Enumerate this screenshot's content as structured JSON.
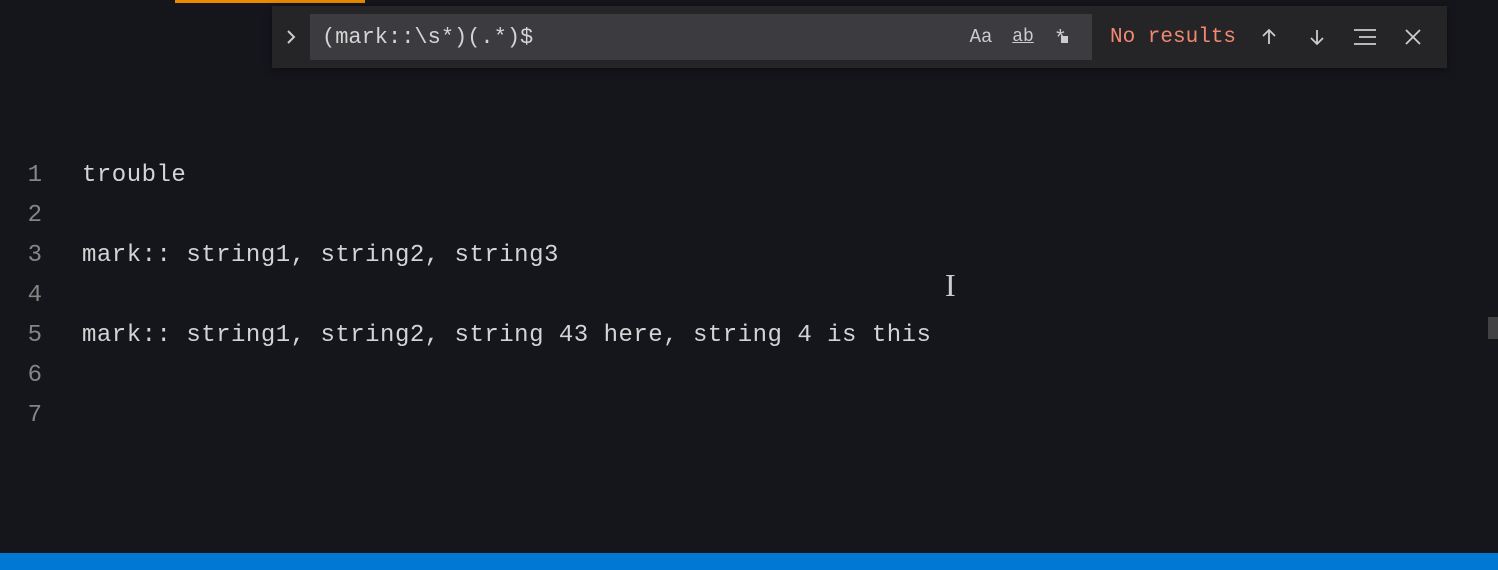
{
  "find": {
    "query": "(mark::\\s*)(.*)$",
    "results_text": "No results",
    "options": {
      "case_label": "Aa",
      "word_label": "ab"
    }
  },
  "editor": {
    "lines": [
      {
        "num": "1",
        "text": "trouble"
      },
      {
        "num": "2",
        "text": ""
      },
      {
        "num": "3",
        "text": "mark:: string1, string2, string3"
      },
      {
        "num": "4",
        "text": ""
      },
      {
        "num": "5",
        "text": "mark:: string1, string2, string 43 here, string 4 is this"
      },
      {
        "num": "6",
        "text": ""
      },
      {
        "num": "7",
        "text": ""
      }
    ]
  }
}
